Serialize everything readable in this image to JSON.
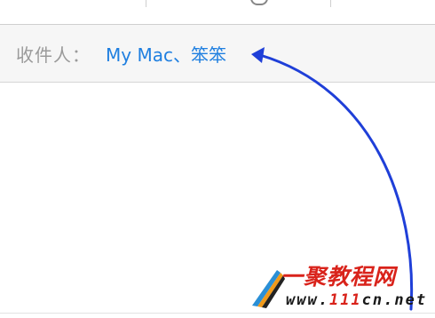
{
  "header": {
    "recipient_label": "收件人：",
    "recipients": "My Mac、笨笨"
  },
  "watermark": {
    "title": "一聚教程网",
    "url_prefix": "www.",
    "url_number": "111",
    "url_suffix": "cn.net"
  },
  "colors": {
    "recipient_text": "#1f7fe0",
    "label_text": "#9a9a9a",
    "arrow": "#1f3fd8",
    "watermark_red": "#d9231b"
  }
}
